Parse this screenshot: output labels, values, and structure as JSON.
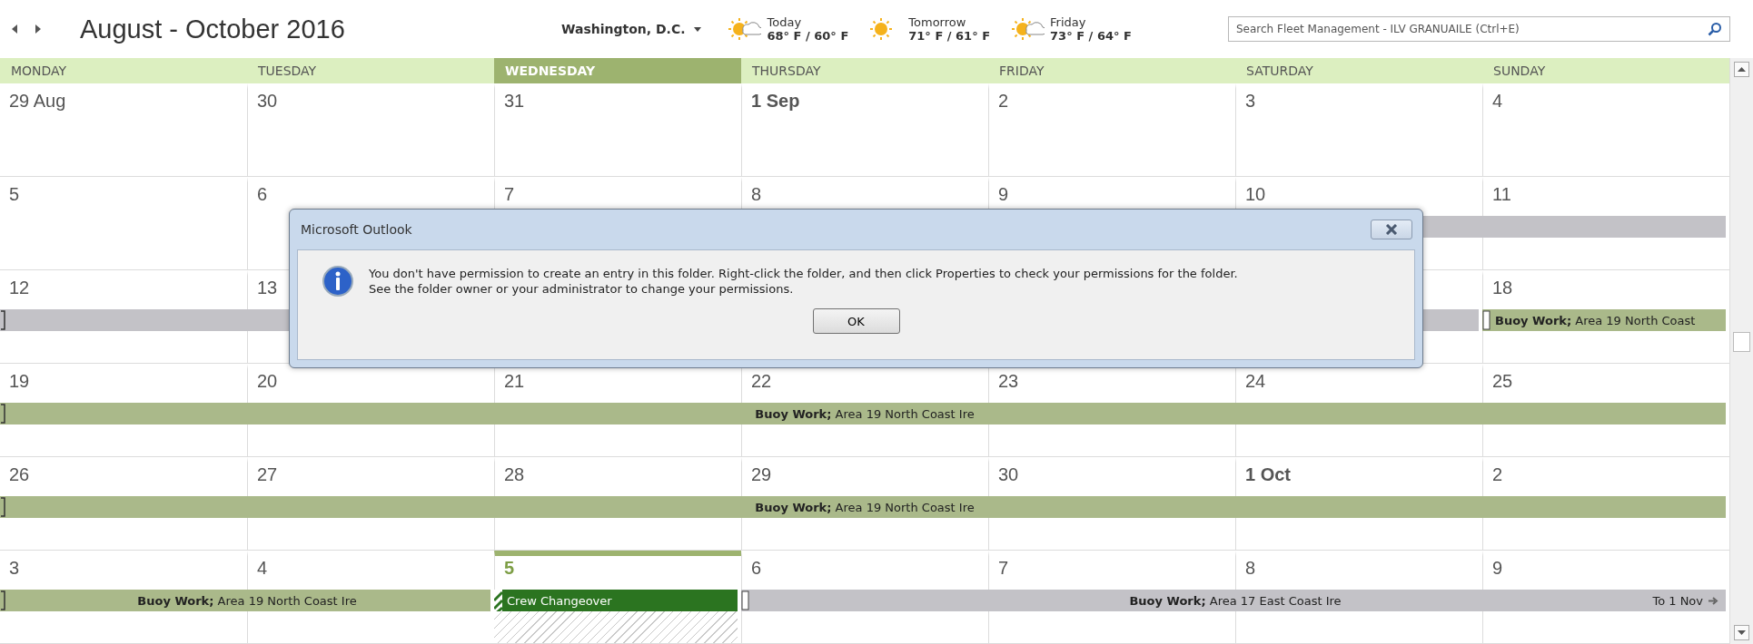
{
  "toolbar": {
    "title": "August - October 2016",
    "location": "Washington, D.C.",
    "weather": [
      {
        "day": "Today",
        "temps": "68° F / 60° F",
        "kind": "partly-sunny"
      },
      {
        "day": "Tomorrow",
        "temps": "71° F / 61° F",
        "kind": "sunny"
      },
      {
        "day": "Friday",
        "temps": "73° F / 64° F",
        "kind": "partly-sunny"
      }
    ],
    "search": {
      "placeholder": "Search Fleet Management - ILV GRANUAILE (Ctrl+E)"
    }
  },
  "weekdays": [
    {
      "label": "MONDAY",
      "selected": false
    },
    {
      "label": "TUESDAY",
      "selected": false
    },
    {
      "label": "WEDNESDAY",
      "selected": true
    },
    {
      "label": "THURSDAY",
      "selected": false
    },
    {
      "label": "FRIDAY",
      "selected": false
    },
    {
      "label": "SATURDAY",
      "selected": false
    },
    {
      "label": "SUNDAY",
      "selected": false
    }
  ],
  "weeks": [
    {
      "days": [
        {
          "label": "29 Aug",
          "bold": false,
          "today": false
        },
        {
          "label": "30",
          "bold": false,
          "today": false
        },
        {
          "label": "31",
          "bold": false,
          "today": false
        },
        {
          "label": "1 Sep",
          "bold": true,
          "today": false
        },
        {
          "label": "2",
          "bold": false,
          "today": false
        },
        {
          "label": "3",
          "bold": false,
          "today": false
        },
        {
          "label": "4",
          "bold": false,
          "today": false
        }
      ]
    },
    {
      "days": [
        {
          "label": "5",
          "bold": false,
          "today": false
        },
        {
          "label": "6",
          "bold": false,
          "today": false
        },
        {
          "label": "7",
          "bold": false,
          "today": false,
          "event": {
            "kind": "start",
            "color": "#c3c2c7"
          }
        },
        {
          "label": "8",
          "bold": false,
          "today": false,
          "event": {
            "kind": "continue"
          }
        },
        {
          "label": "9",
          "bold": false,
          "today": false,
          "event": {
            "kind": "continue"
          }
        },
        {
          "label": "10",
          "bold": false,
          "today": false,
          "event": {
            "kind": "continue"
          }
        },
        {
          "label": "11",
          "bold": false,
          "today": false,
          "event": {
            "kind": "continue"
          }
        }
      ]
    },
    {
      "days": [
        {
          "label": "12",
          "bold": false,
          "today": false,
          "event": {
            "kind": "start",
            "color": "#c3c2c7",
            "marker": {
              "kind": "bracket"
            }
          }
        },
        {
          "label": "13",
          "bold": false,
          "today": false,
          "event": {
            "kind": "continue"
          }
        },
        {
          "event": {
            "kind": "continue"
          }
        },
        {
          "event": {
            "kind": "continue"
          }
        },
        {
          "event": {
            "kind": "continue"
          }
        },
        {
          "event": {
            "kind": "continue"
          }
        },
        {
          "label": "18",
          "bold": false,
          "today": false,
          "event": {
            "kind": "start",
            "color": "#aab98a",
            "marker": {
              "kind": "box"
            },
            "title": "**Buoy Work;** Area 19 North Coast"
          }
        }
      ]
    },
    {
      "days": [
        {
          "label": "19",
          "bold": false,
          "today": false,
          "event": {
            "kind": "start",
            "color": "#aab98a",
            "marker": {
              "kind": "bracket"
            },
            "title": "**Buoy Work;** Area 19 North Coast Ire"
          }
        },
        {
          "label": "20",
          "bold": false,
          "today": false,
          "event": {
            "kind": "continue"
          }
        },
        {
          "label": "21",
          "bold": false,
          "today": false,
          "event": {
            "kind": "continue"
          }
        },
        {
          "label": "22",
          "bold": false,
          "today": false,
          "event": {
            "kind": "continue"
          }
        },
        {
          "label": "23",
          "bold": false,
          "today": false,
          "event": {
            "kind": "continue"
          }
        },
        {
          "label": "24",
          "bold": false,
          "today": false,
          "event": {
            "kind": "continue"
          }
        },
        {
          "label": "25",
          "bold": false,
          "today": false,
          "event": {
            "kind": "continue"
          }
        }
      ]
    },
    {
      "days": [
        {
          "label": "26",
          "bold": false,
          "today": false,
          "event": {
            "kind": "start",
            "color": "#aab98a",
            "marker": {
              "kind": "bracket"
            },
            "title": "**Buoy Work;** Area 19 North Coast Ire"
          }
        },
        {
          "label": "27",
          "bold": false,
          "today": false,
          "event": {
            "kind": "continue"
          }
        },
        {
          "label": "28",
          "bold": false,
          "today": false,
          "event": {
            "kind": "continue"
          }
        },
        {
          "label": "29",
          "bold": false,
          "today": false,
          "event": {
            "kind": "continue"
          }
        },
        {
          "label": "30",
          "bold": false,
          "today": false,
          "event": {
            "kind": "continue"
          }
        },
        {
          "label": "1 Oct",
          "bold": true,
          "today": false,
          "event": {
            "kind": "continue"
          }
        },
        {
          "label": "2",
          "bold": false,
          "today": false,
          "event": {
            "kind": "continue"
          }
        }
      ]
    },
    {
      "days": [
        {
          "label": "3",
          "bold": false,
          "today": false,
          "event": {
            "kind": "start",
            "color": "#aab98a",
            "marker": {
              "kind": "bracket"
            },
            "title": "**Buoy Work;** Area 19 North Coast Ire"
          }
        },
        {
          "label": "4",
          "bold": false,
          "today": false,
          "event": {
            "kind": "continue"
          }
        },
        {
          "label": "5",
          "bold": false,
          "today": true,
          "event": {
            "kind": "start",
            "color": "#2b7420",
            "marker": {
              "kind": "hatch"
            },
            "title": "Crew Changeover",
            "hatched_below": true
          }
        },
        {
          "label": "6",
          "bold": false,
          "today": false,
          "event": {
            "kind": "start",
            "color": "#c3c2c7",
            "marker": {
              "kind": "box"
            },
            "title": "**Buoy Work;** Area 17 East Coast Ire",
            "end_text": "To 1 Nov"
          }
        },
        {
          "label": "7",
          "bold": false,
          "today": false,
          "event": {
            "kind": "continue"
          }
        },
        {
          "label": "8",
          "bold": false,
          "today": false,
          "event": {
            "kind": "continue"
          }
        },
        {
          "label": "9",
          "bold": false,
          "today": false,
          "event": {
            "kind": "continue"
          }
        }
      ]
    }
  ],
  "dialog": {
    "title": "Microsoft Outlook",
    "message": [
      "You don't have permission to create an entry in this folder. Right-click the folder, and then click Properties to check your permissions for the folder.",
      "See the folder owner or your administrator to change your permissions."
    ],
    "button": "OK"
  }
}
